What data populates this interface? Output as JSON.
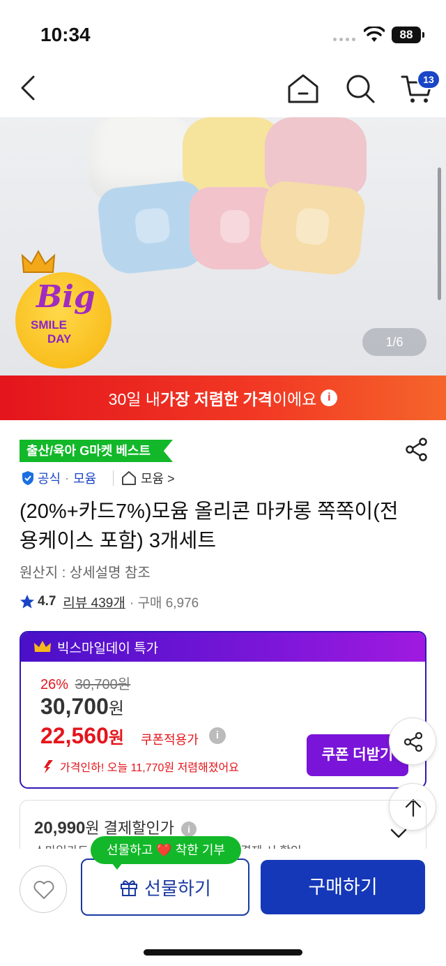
{
  "status": {
    "time": "10:34",
    "battery": "88"
  },
  "nav": {
    "cart_count": "13"
  },
  "hero": {
    "badge_big": "Big",
    "badge_smile": "SMILE",
    "badge_day": "DAY",
    "counter": "1/6"
  },
  "promo": {
    "prefix": "30일 내 ",
    "highlight": "가장 저렴한 가격",
    "suffix": "이에요",
    "info": "i"
  },
  "product": {
    "best_badge": "출산/육아 G마켓 베스트",
    "official": "공식",
    "sep": "·",
    "brand": "모윰",
    "store": "모윰 >",
    "title": "(20%+카드7%)모윰 올리콘 마카롱 쪽쪽이(전용케이스 포함) 3개세트",
    "origin": "원산지 : 상세설명 참조",
    "rating": "4.7",
    "reviews": "리뷰 439개",
    "purchases": "· 구매 6,976"
  },
  "deal": {
    "header": "빅스마일데이 특가",
    "discount_rate": "26%",
    "original_price": "30,700원",
    "price_value": "30,700",
    "price_unit": "원",
    "coupon_value": "22,560",
    "coupon_unit": "원",
    "coupon_label": "쿠폰적용가",
    "info": "i",
    "drop_message": "가격인하! 오늘 11,770원 저렴해졌어요",
    "coupon_button": "쿠폰 더받기"
  },
  "payment": {
    "price_value": "20,990",
    "price_unit": "원",
    "label": "결제할인가",
    "info": "i",
    "sub_left": "스마일카드",
    "sub_right": "결제 시 할인"
  },
  "bottom": {
    "gift_tip": "선물하고 ❤️ 착한 기부",
    "gift_button": "선물하기",
    "buy_button": "구매하기"
  },
  "colors": {
    "brand_blue": "#1538b8",
    "promo_red": "#e4151c",
    "deal_purple": "#7a14d8",
    "best_green": "#12b829"
  }
}
